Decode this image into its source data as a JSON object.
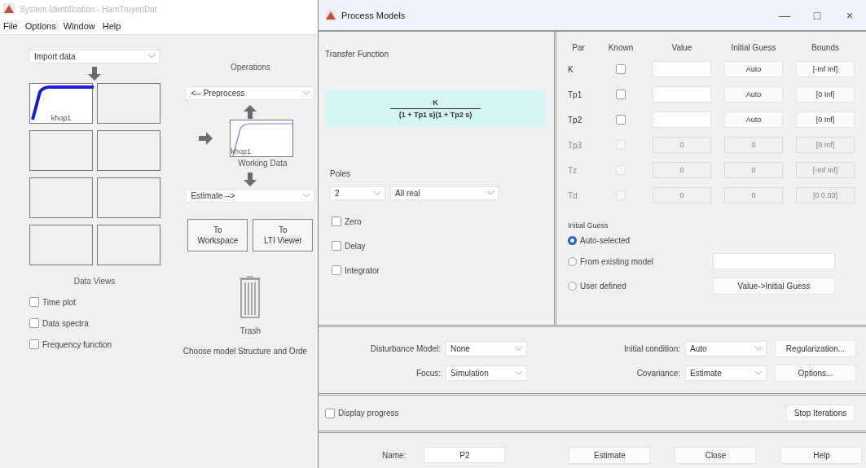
{
  "back_window": {
    "title": "System Identification - HamTruyenDat",
    "menu": [
      "File",
      "Options",
      "Window",
      "Help"
    ],
    "import": {
      "value": "Import data"
    },
    "data_slots": [
      {
        "kind": "data",
        "label": "khop1"
      },
      {
        "kind": "empty"
      },
      {
        "kind": "empty"
      },
      {
        "kind": "empty"
      },
      {
        "kind": "empty"
      },
      {
        "kind": "empty"
      },
      {
        "kind": "empty"
      },
      {
        "kind": "empty"
      }
    ],
    "data_views_title": "Data Views",
    "data_views": [
      {
        "label": "Time plot",
        "checked": false
      },
      {
        "label": "Data spectra",
        "checked": false
      },
      {
        "label": "Frequency function",
        "checked": false
      }
    ],
    "operations_title": "Operations",
    "preprocess": {
      "value": "<-- Preprocess"
    },
    "working_data": {
      "label": "khop1",
      "caption": "Working Data"
    },
    "estimate": {
      "value": "Estimate -->"
    },
    "buttons": [
      {
        "lines": [
          "To",
          "Workspace"
        ]
      },
      {
        "lines": [
          "To",
          "LTI Viewer"
        ]
      }
    ],
    "trash": {
      "label": "Trash"
    },
    "status": "Choose model Structure and Orde"
  },
  "dialog": {
    "title": "Process Models",
    "controls": [
      "—",
      "□",
      "×"
    ],
    "transfer_function": {
      "title": "Transfer Function",
      "numerator": "K",
      "denominator": "(1 + Tp1 s)(1 + Tp2 s)"
    },
    "poles": {
      "label": "Poles",
      "count": "2",
      "type": "All real"
    },
    "options": [
      {
        "label": "Zero",
        "checked": false
      },
      {
        "label": "Delay",
        "checked": false
      },
      {
        "label": "Integrator",
        "checked": false
      }
    ],
    "parameters": {
      "columns": [
        "Par",
        "Known",
        "Value",
        "Initial Guess",
        "Bounds"
      ],
      "rows": [
        {
          "par": "K",
          "known": false,
          "initial_guess": "Auto",
          "bounds": "[-Inf Inf]",
          "disabled": false
        },
        {
          "par": "Tp1",
          "known": false,
          "initial_guess": "Auto",
          "bounds": "[0 Inf]",
          "disabled": false
        },
        {
          "par": "Tp2",
          "known": false,
          "initial_guess": "Auto",
          "bounds": "[0 Inf]",
          "disabled": false
        },
        {
          "par": "Tp3",
          "known": false,
          "value": "0",
          "initial_guess": "0",
          "bounds": "[0 Inf]",
          "disabled": true
        },
        {
          "par": "Tz",
          "known": false,
          "value": "0",
          "initial_guess": "0",
          "bounds": "[-Inf Inf]",
          "disabled": true
        },
        {
          "par": "Td",
          "known": false,
          "value": "0",
          "initial_guess": "0",
          "bounds": "[0 0.03]",
          "disabled": true
        }
      ]
    },
    "initial_guess": {
      "title": "Initial Guess",
      "choices": [
        {
          "label": "Auto-selected",
          "selected": true
        },
        {
          "label": "From existing model",
          "selected": false
        },
        {
          "label": "User defined",
          "selected": false
        }
      ],
      "button": "Value->Initial Guess"
    },
    "settings_rows": [
      {
        "left": {
          "label": "Disturbance Model:",
          "value": "None"
        },
        "right": {
          "label": "Initial condition:",
          "value": "Auto"
        },
        "button": "Regularization..."
      },
      {
        "left": {
          "label": "Focus:",
          "value": "Simulation"
        },
        "right": {
          "label": "Covariance:",
          "value": "Estimate"
        },
        "button": "Options..."
      }
    ],
    "display_progress": {
      "label": "Display progress",
      "checked": false
    },
    "stop_button": "Stop Iterations",
    "name": {
      "label": "Name:",
      "value": "P2"
    },
    "actions": [
      "Estimate",
      "Close",
      "Help"
    ]
  }
}
